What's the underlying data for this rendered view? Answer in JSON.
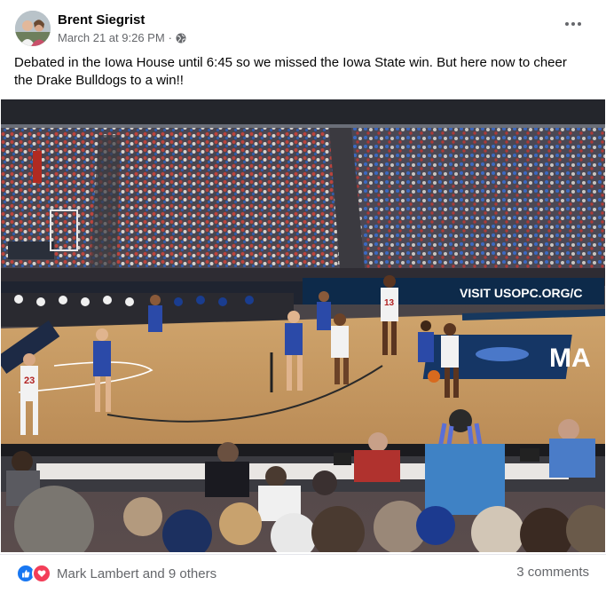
{
  "post": {
    "author": "Brent Siegrist",
    "timestamp": "March 21 at 9:26 PM",
    "separator": "·",
    "audience_icon": "globe-icon",
    "more_icon": "more-options-icon",
    "text_line1": "Debated in the Iowa House until 6:45 so we missed the Iowa State win.  But here now to cheer",
    "text_line2": "the Drake Bulldogs to a win!!"
  },
  "photo": {
    "banner_text": "VISIT USOPC.ORG/C",
    "court_text": "MA",
    "jersey_a": "23",
    "jersey_b": "13"
  },
  "footer": {
    "reaction_icons": [
      "like-icon",
      "love-icon"
    ],
    "reactions_text": "Mark Lambert and 9 others",
    "comments_text": "3 comments"
  },
  "colors": {
    "text": "#050505",
    "secondary": "#65676b",
    "like": "#1877f2",
    "love": "#f33e58",
    "divider": "#e4e6eb"
  }
}
